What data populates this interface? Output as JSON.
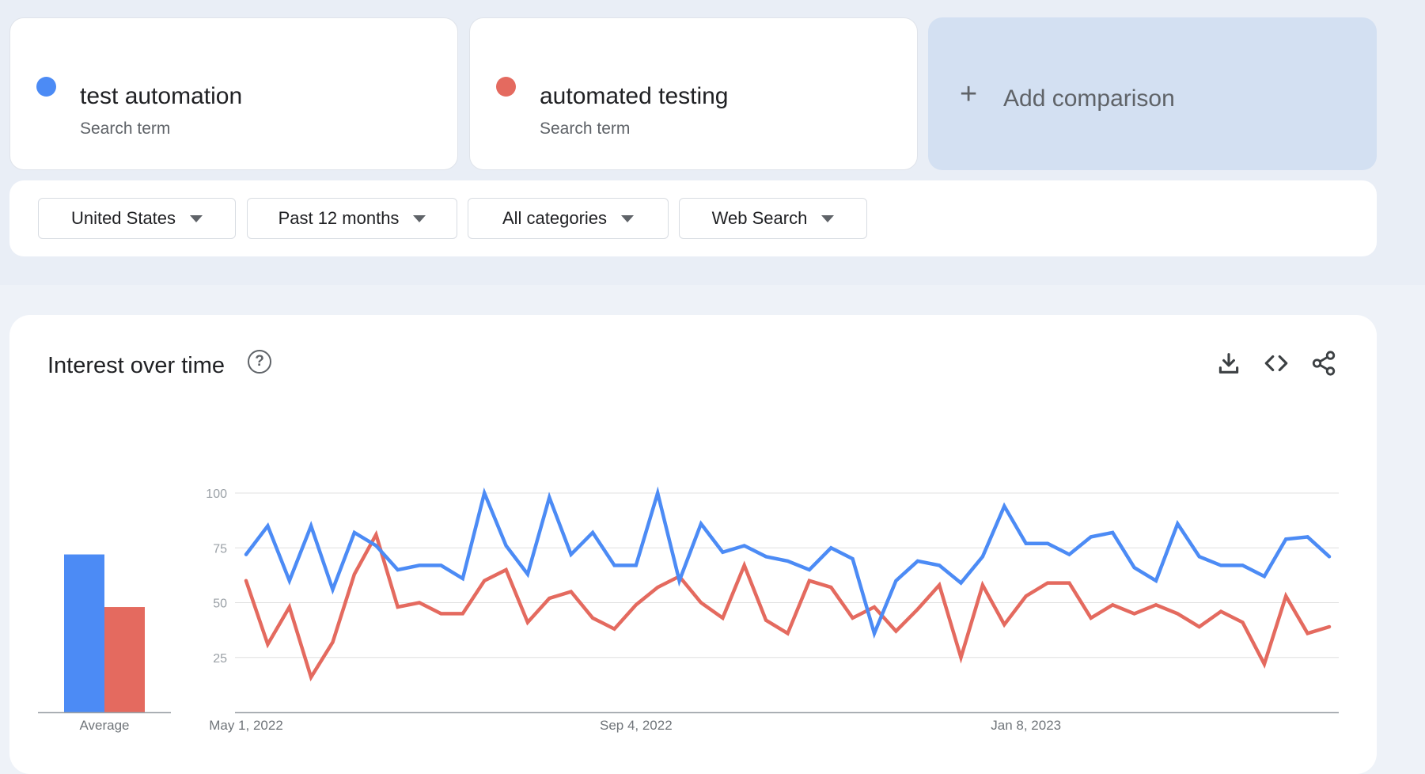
{
  "terms": [
    {
      "term": "test automation",
      "sub": "Search term",
      "color": "#4c8bf5"
    },
    {
      "term": "automated testing",
      "sub": "Search term",
      "color": "#e46a5f"
    }
  ],
  "add_comparison": {
    "label": "Add comparison",
    "plus": "+"
  },
  "filters": [
    {
      "label": "United States"
    },
    {
      "label": "Past 12 months"
    },
    {
      "label": "All categories"
    },
    {
      "label": "Web Search"
    }
  ],
  "panel": {
    "title": "Interest over time",
    "help_glyph": "?",
    "tools": [
      "download-icon",
      "embed-code-icon",
      "share-icon"
    ]
  },
  "chart_data": [
    {
      "type": "bar",
      "categories": [
        "test automation",
        "automated testing"
      ],
      "values": [
        72,
        48
      ],
      "xlabel": "Average",
      "ylim": [
        0,
        100
      ],
      "colors": [
        "#4c8bf5",
        "#e46a5f"
      ]
    },
    {
      "type": "line",
      "x_tick_labels": [
        "May 1, 2022",
        "Sep 4, 2022",
        "Jan 8, 2023"
      ],
      "x_tick_index": [
        0,
        18,
        36
      ],
      "y_ticks": [
        25,
        50,
        75,
        100
      ],
      "ylim": [
        0,
        100
      ],
      "grid": true,
      "series": [
        {
          "name": "test automation",
          "color": "#4c8bf5",
          "values": [
            72,
            85,
            60,
            85,
            56,
            82,
            76,
            65,
            67,
            67,
            61,
            100,
            76,
            63,
            98,
            72,
            82,
            67,
            67,
            100,
            60,
            86,
            73,
            76,
            71,
            69,
            65,
            75,
            70,
            36,
            60,
            69,
            67,
            59,
            71,
            94,
            77,
            77,
            72,
            80,
            82,
            66,
            60,
            86,
            71,
            67,
            67,
            62,
            79,
            80,
            71
          ]
        },
        {
          "name": "automated testing",
          "color": "#e46a5f",
          "values": [
            60,
            31,
            48,
            16,
            32,
            63,
            81,
            48,
            50,
            45,
            45,
            60,
            65,
            41,
            52,
            55,
            43,
            38,
            49,
            57,
            62,
            50,
            43,
            67,
            42,
            36,
            60,
            57,
            43,
            48,
            37,
            47,
            58,
            25,
            58,
            40,
            53,
            59,
            59,
            43,
            49,
            45,
            49,
            45,
            39,
            46,
            41,
            22,
            53,
            36,
            39
          ]
        }
      ]
    }
  ]
}
